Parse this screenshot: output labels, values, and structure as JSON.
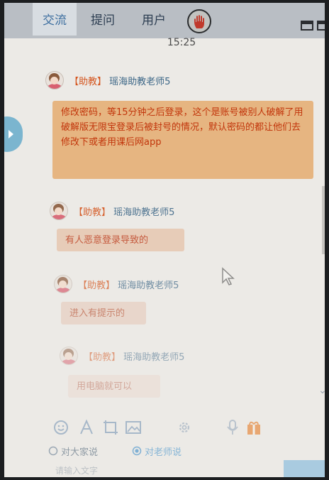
{
  "tabs": [
    {
      "label": "交流",
      "active": true
    },
    {
      "label": "提问",
      "active": false
    },
    {
      "label": "用户",
      "active": false
    }
  ],
  "header": {
    "hand_icon": "raise-hand-icon",
    "window_icons": [
      "window-icon",
      "sidebar-window-icon"
    ]
  },
  "chat": {
    "time": "15:25",
    "messages": [
      {
        "tag": "【助教】",
        "sender": "瑶海助教老师5",
        "text": "修改密码，等15分钟之后登录，这个是账号被别人破解了用破解版无限宝登录后被封号的情况，默认密码的都让他们去修改下或者用课后网app"
      },
      {
        "tag": "【助教】",
        "sender": "瑶海助教老师5",
        "text": "有人恶意登录导致的"
      },
      {
        "tag": "【助教】",
        "sender": "瑶海助教老师5",
        "text": "进入有提示的"
      },
      {
        "tag": "【助教】",
        "sender": "瑶海助教老师5",
        "text": "用电脑就可以"
      }
    ]
  },
  "toolbar": {
    "icons": [
      "emoji-icon",
      "font-icon",
      "screenshot-icon",
      "image-icon",
      "settings-icon",
      "microphone-icon",
      "gift-icon"
    ]
  },
  "audience": {
    "options": [
      {
        "label": "对大家说",
        "selected": false
      },
      {
        "label": "对老师说",
        "selected": true
      }
    ]
  },
  "input": {
    "placeholder": "请输入文字"
  },
  "colors": {
    "tab_bar": "#b9bec4",
    "active_tab_text": "#3e6fa0",
    "tag_color": "#d4551e",
    "sender_color": "#3d6787",
    "bubble_bg": "#e6b581",
    "bubble_text": "#c2360c",
    "toggle": "#7bb5cf"
  }
}
